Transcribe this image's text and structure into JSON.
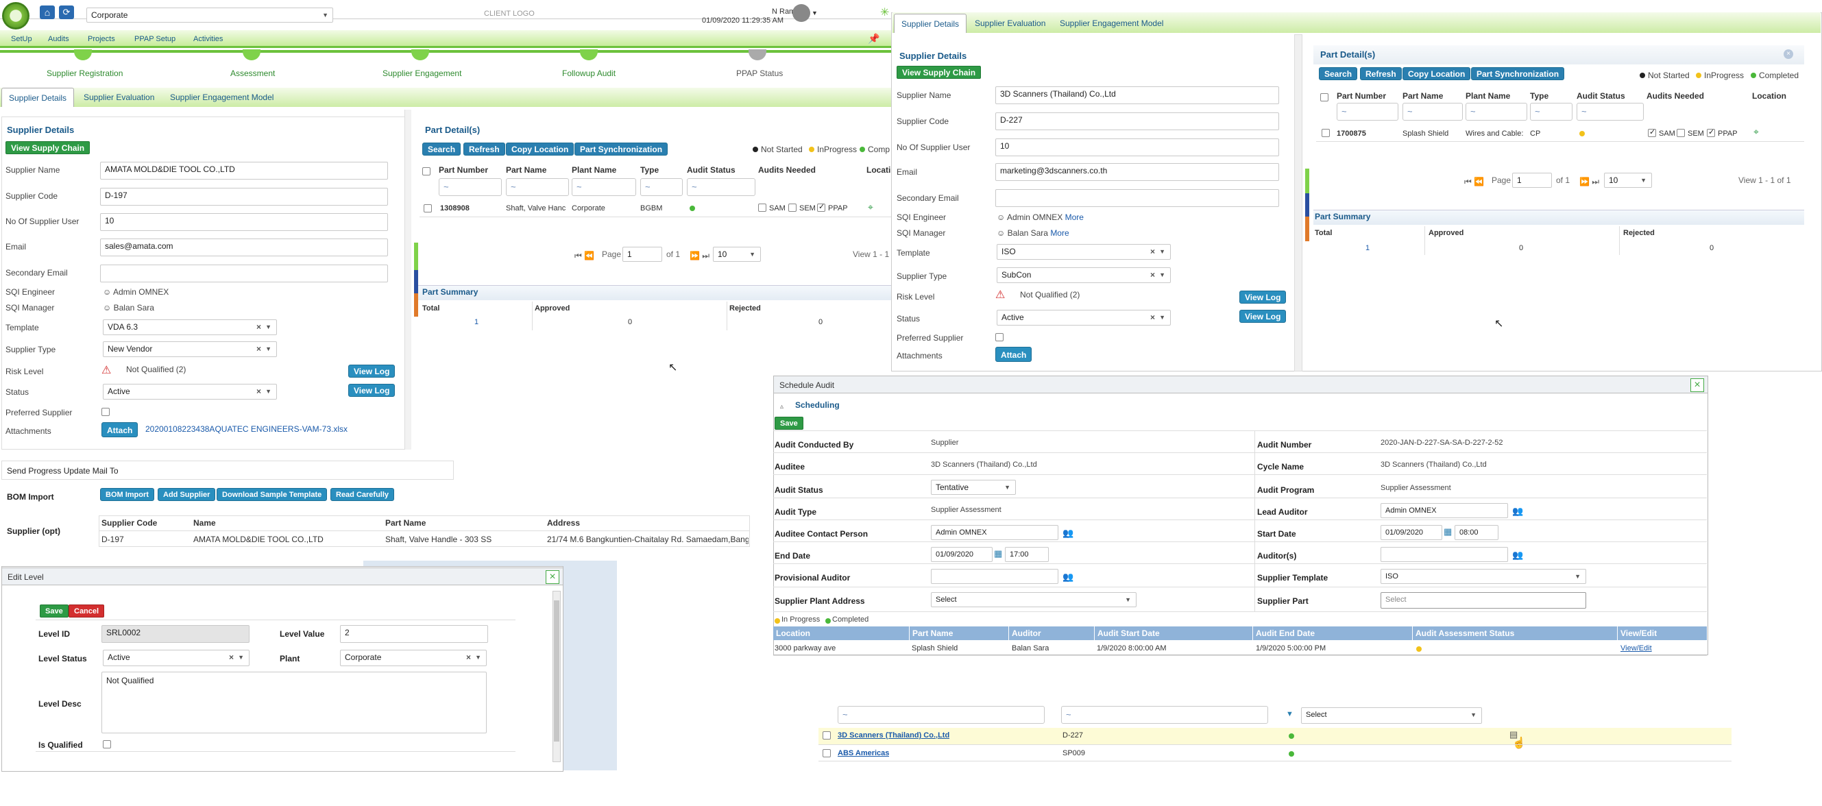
{
  "topbar": {
    "company": "Corporate",
    "client_logo": "CLIENT LOGO",
    "user": "N Ramya",
    "datetime": "01/09/2020 11:29:35 AM"
  },
  "menu": [
    "SetUp",
    "Audits",
    "Projects",
    "PPAP Setup",
    "Activities"
  ],
  "progress_steps": [
    "Supplier Registration",
    "Assessment",
    "Supplier Engagement",
    "Followup Audit",
    "PPAP Status"
  ],
  "tabs": [
    "Supplier Details",
    "Supplier Evaluation",
    "Supplier Engagement Model"
  ],
  "left_supplier": {
    "title": "Supplier Details",
    "view_supply_chain": "View Supply Chain",
    "labels": {
      "name": "Supplier Name",
      "code": "Supplier Code",
      "users": "No Of Supplier User",
      "email": "Email",
      "sec_email": "Secondary Email",
      "sqi_eng": "SQI Engineer",
      "sqi_mgr": "SQI Manager",
      "template": "Template",
      "type": "Supplier Type",
      "risk": "Risk Level",
      "status": "Status",
      "preferred": "Preferred Supplier",
      "attachments": "Attachments"
    },
    "name": "AMATA MOLD&DIE TOOL CO.,LTD",
    "code": "D-197",
    "users": "10",
    "email": "sales@amata.com",
    "sqi_eng": "Admin OMNEX",
    "sqi_mgr": "Balan Sara",
    "template": "VDA 6.3",
    "type": "New Vendor",
    "risk": "Not Qualified (2)",
    "status": "Active",
    "view_log": "View Log",
    "attach": "Attach",
    "attachment_file": "20200108223438AQUATEC ENGINEERS-VAM-73.xlsx"
  },
  "left_parts": {
    "title": "Part Detail(s)",
    "buttons": [
      "Search",
      "Refresh",
      "Copy Location",
      "Part Synchronization"
    ],
    "legend": [
      "Not Started",
      "InProgress",
      "Comp"
    ],
    "headers": [
      "Part Number",
      "Part Name",
      "Plant Name",
      "Type",
      "Audit Status",
      "Audits Needed",
      "Locati"
    ],
    "row": {
      "part_number": "1308908",
      "part_name": "Shaft, Valve Hanc",
      "plant": "Corporate",
      "type": "BGBM",
      "sam": "SAM",
      "sem": "SEM",
      "ppap": "PPAP"
    },
    "pager": {
      "page_label": "Page",
      "page": "1",
      "of": "of 1",
      "size": "10",
      "view": "View 1 - 1"
    }
  },
  "left_summary": {
    "title": "Part Summary",
    "headers": [
      "Total",
      "Approved",
      "Rejected"
    ],
    "values": [
      "1",
      "0",
      "0"
    ]
  },
  "progress_mail": "Send Progress Update Mail To",
  "bom": {
    "label": "BOM Import",
    "buttons": [
      "BOM Import",
      "Add Supplier",
      "Download Sample Template",
      "Read Carefully"
    ],
    "supplier_label": "Supplier (opt)",
    "headers": [
      "Supplier Code",
      "Name",
      "Part Name",
      "Address"
    ],
    "row": [
      "D-197",
      "AMATA MOLD&DIE TOOL CO.,LTD",
      "Shaft, Valve Handle - 303 SS",
      "21/74 M.6 Bangkuntien-Chaitalay Rd. Samaedam,Bangk"
    ]
  },
  "edit_level": {
    "title": "Edit Level",
    "save": "Save",
    "cancel": "Cancel",
    "labels": {
      "id": "Level ID",
      "value": "Level Value",
      "status": "Level Status",
      "plant": "Plant",
      "desc": "Level Desc",
      "qualified": "Is Qualified"
    },
    "id": "SRL0002",
    "value": "2",
    "status": "Active",
    "plant": "Corporate",
    "desc": "Not Qualified"
  },
  "right_supplier": {
    "title": "Supplier Details",
    "view_supply_chain": "View Supply Chain",
    "name": "3D Scanners (Thailand) Co.,Ltd",
    "code": "D-227",
    "users": "10",
    "email": "marketing@3dscanners.co.th",
    "sqi_eng": "Admin OMNEX",
    "sqi_mgr": "Balan Sara",
    "more": "More",
    "template": "ISO",
    "type": "SubCon",
    "risk": "Not Qualified (2)",
    "status": "Active"
  },
  "right_parts": {
    "title": "Part Detail(s)",
    "legend": [
      "Not Started",
      "InProgress",
      "Completed"
    ],
    "headers": [
      "Part Number",
      "Part Name",
      "Plant Name",
      "Type",
      "Audit Status",
      "Audits Needed",
      "Location"
    ],
    "row": {
      "part_number": "1700875",
      "part_name": "Splash Shield",
      "plant": "Wires and Cable:",
      "type": "CP"
    },
    "pager": {
      "view": "View 1 - 1 of 1"
    }
  },
  "schedule": {
    "title": "Schedule Audit",
    "section": "Scheduling",
    "save": "Save",
    "labels": {
      "conducted_by": "Audit Conducted By",
      "auditee": "Auditee",
      "audit_status": "Audit Status",
      "audit_type": "Audit Type",
      "contact": "Auditee Contact Person",
      "end_date": "End Date",
      "prov_auditor": "Provisional Auditor",
      "plant_addr": "Supplier Plant Address",
      "audit_number": "Audit Number",
      "cycle_name": "Cycle Name",
      "audit_program": "Audit Program",
      "lead_auditor": "Lead Auditor",
      "start_date": "Start Date",
      "auditors": "Auditor(s)",
      "supplier_template": "Supplier Template",
      "supplier_part": "Supplier Part"
    },
    "conducted_by": "Supplier",
    "auditee": "3D Scanners (Thailand) Co.,Ltd",
    "audit_status": "Tentative",
    "audit_type": "Supplier Assessment",
    "contact": "Admin OMNEX",
    "end_date": "01/09/2020",
    "end_time": "17:00",
    "plant_addr": "Select",
    "audit_number": "2020-JAN-D-227-SA-SA-D-227-2-52",
    "cycle_name": "3D Scanners (Thailand) Co.,Ltd",
    "audit_program": "Supplier Assessment",
    "lead_auditor": "Admin OMNEX",
    "start_date": "01/09/2020",
    "start_time": "08:00",
    "supplier_template": "ISO",
    "supplier_part": "Select",
    "legend": [
      "In Progress",
      "Completed"
    ],
    "grid_headers": [
      "Location",
      "Part Name",
      "Auditor",
      "Audit Start Date",
      "Audit End Date",
      "Audit Assessment Status",
      "View/Edit"
    ],
    "grid_row": [
      "3000 parkway ave",
      "Splash Shield",
      "Balan Sara",
      "1/9/2020 8:00:00 AM",
      "1/9/2020 5:00:00 PM",
      "",
      "View/Edit"
    ]
  },
  "bottom_list": {
    "filter_select": "Select",
    "rows": [
      {
        "name": "3D Scanners (Thailand) Co.,Ltd",
        "code": "D-227"
      },
      {
        "name": "ABS Americas",
        "code": "SP009"
      }
    ]
  }
}
